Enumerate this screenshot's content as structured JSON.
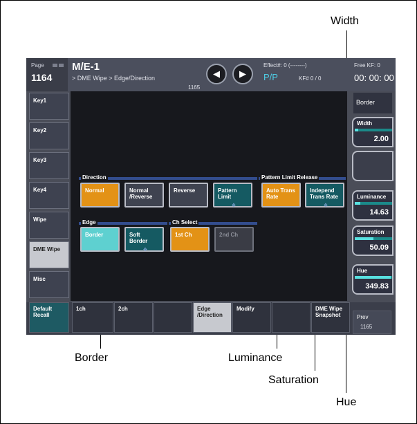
{
  "callouts": {
    "width": "Width",
    "border": "Border",
    "luminance": "Luminance",
    "saturation": "Saturation",
    "hue": "Hue"
  },
  "header": {
    "page_label": "Page",
    "page_number": "1164",
    "title": "M/E-1",
    "breadcrumb": "> DME Wipe > Edge/Direction",
    "page_number_below": "1165",
    "effect": "Effect#: 0 (--------)",
    "mode": "P/P",
    "kf": "KF# 0 / 0",
    "free_kf": "Free KF: 0",
    "timecode": "00: 00: 00"
  },
  "sidebar": {
    "items": [
      {
        "label": "Key1"
      },
      {
        "label": "Key2"
      },
      {
        "label": "Key3"
      },
      {
        "label": "Key4"
      },
      {
        "label": "Wipe"
      },
      {
        "label": "DME Wipe",
        "active": true
      },
      {
        "label": "Misc"
      }
    ]
  },
  "groups": {
    "direction": "Direction",
    "pattern_limit_release": "Pattern Limit Release",
    "edge": "Edge",
    "ch_select": "Ch Select"
  },
  "buttons": {
    "normal": "Normal",
    "normal_reverse": "Normal\n/Reverse",
    "reverse": "Reverse",
    "pattern_limit": "Pattern\nLimit",
    "auto_trans_rate": "Auto Trans\nRate",
    "independ_trans_rate": "Independ\nTrans Rate",
    "border": "Border",
    "soft_border": "Soft\nBorder",
    "first_ch": "1st Ch",
    "second_ch": "2nd Ch"
  },
  "right_panel": {
    "border_label": "Border",
    "width": {
      "label": "Width",
      "value": "2.00",
      "level": 0.1
    },
    "luminance": {
      "label": "Luminance",
      "value": "14.63",
      "level": 0.15
    },
    "saturation": {
      "label": "Saturation",
      "value": "50.09",
      "level": 0.5
    },
    "hue": {
      "label": "Hue",
      "value": "349.83",
      "level": 0.97
    }
  },
  "footer": {
    "default_recall": "Default\nRecall",
    "tab_1ch": "1ch",
    "tab_2ch": "2ch",
    "tab_edge": "Edge\n/Direction",
    "tab_modify": "Modify",
    "snapshot": "DME Wipe\nSnapshot",
    "prev": "Prev",
    "prev_page": "1165"
  },
  "colors": {
    "accent_orange": "#e39216",
    "accent_cyan": "#5ed0d0",
    "teal": "#155a62",
    "group_bar": "#334d8e",
    "pp_color": "#4ed0e8"
  }
}
